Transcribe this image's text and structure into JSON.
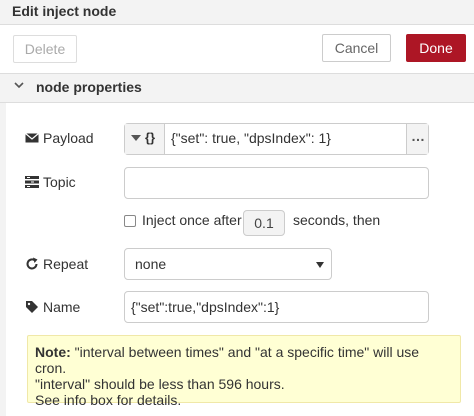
{
  "dialog": {
    "title": "Edit inject node",
    "delete_label": "Delete",
    "cancel_label": "Cancel",
    "done_label": "Done"
  },
  "section": {
    "title": "node properties"
  },
  "form": {
    "payload_label": "Payload",
    "payload_type": "{}",
    "payload_value": "{\"set\": true, \"dpsIndex\": 1}",
    "payload_expand": "…",
    "topic_label": "Topic",
    "topic_value": "",
    "inject_once_label": "Inject once after",
    "inject_once_checked": false,
    "inject_delay_value": "0.1",
    "inject_delay_suffix": "seconds, then",
    "repeat_label": "Repeat",
    "repeat_value": "none",
    "name_label": "Name",
    "name_value": "{\"set\":true,\"dpsIndex\":1}"
  },
  "tip": {
    "note_label": "Note:",
    "line1": " \"interval between times\" and \"at a specific time\" will use cron.",
    "line2": "\"interval\" should be less than 596 hours.",
    "line3": "See info box for details."
  },
  "colors": {
    "done_button": "#ad1625",
    "tip_background": "#ffffd4",
    "panel_background": "#f3f3f3"
  },
  "icons": {
    "payload": "envelope-icon",
    "topic": "tasks-icon",
    "repeat": "repeat-icon",
    "name": "tag-icon",
    "section": "chevron-down-icon"
  }
}
